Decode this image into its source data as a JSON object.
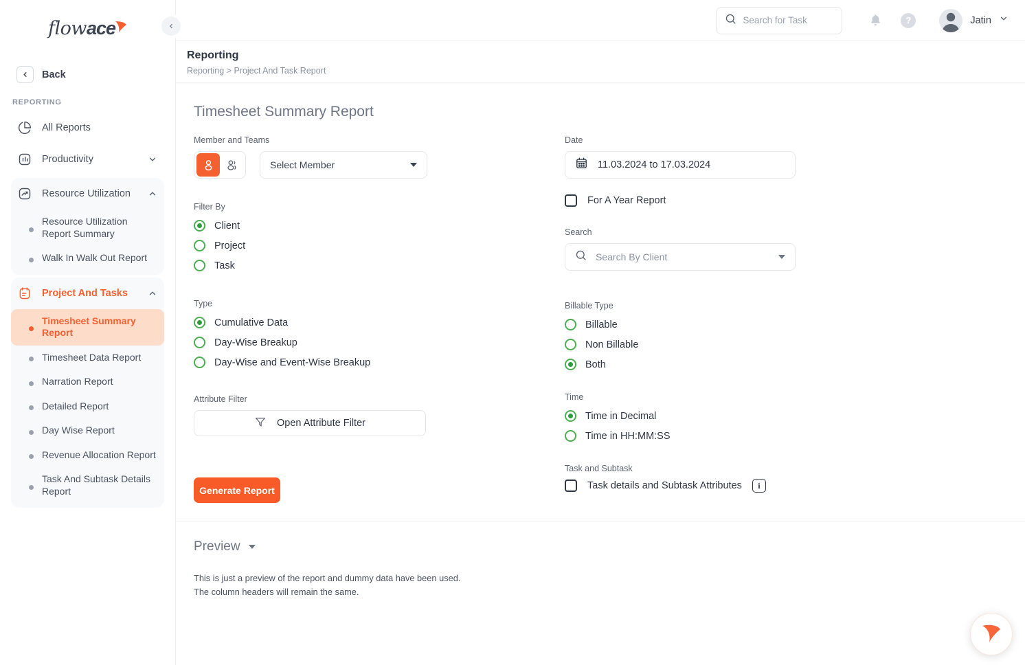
{
  "brand": {
    "logo_text_light": "flow",
    "logo_text_bold": "ace",
    "accent_orange": "#f4602f",
    "button_orange": "#f85a28",
    "radio_green": "#4caf50"
  },
  "sidebar": {
    "back_label": "Back",
    "section_title": "REPORTING",
    "items": [
      {
        "label": "All Reports",
        "icon": "pie-chart-icon"
      },
      {
        "label": "Productivity",
        "icon": "bar-chart-icon",
        "chevron": "chevron-down-icon"
      },
      {
        "label": "Resource Utilization",
        "icon": "trending-up-icon",
        "chevron": "chevron-up-icon"
      }
    ],
    "resource_utilization_children": [
      {
        "label": "Resource Utilization Report Summary"
      },
      {
        "label": "Walk In Walk Out Report"
      }
    ],
    "project_and_tasks": {
      "label": "Project And Tasks",
      "icon": "clipboard-list-icon",
      "chevron": "chevron-up-icon"
    },
    "project_and_tasks_children": [
      {
        "label": "Timesheet Summary Report",
        "active": true
      },
      {
        "label": "Timesheet Data Report",
        "active": false
      },
      {
        "label": "Narration Report",
        "active": false
      },
      {
        "label": "Detailed Report",
        "active": false
      },
      {
        "label": "Day Wise Report",
        "active": false
      },
      {
        "label": "Revenue Allocation Report",
        "active": false
      },
      {
        "label": "Task And Subtask Details Report",
        "active": false
      }
    ]
  },
  "topbar": {
    "search_placeholder": "Search for Task",
    "search_value": "",
    "search_icon": "search-icon",
    "bell_icon": "bell-icon",
    "help_icon": "question-mark-icon",
    "help_label": "?",
    "avatar_icon": "avatar-icon",
    "user_name": "Jatin",
    "user_chevron": "chevron-down-icon",
    "collapse_icon": "chevron-left-icon"
  },
  "page": {
    "title": "Reporting",
    "breadcrumb": "Reporting > Project And Task Report",
    "card_title": "Timesheet Summary Report"
  },
  "form": {
    "member_and_teams": {
      "label": "Member and Teams",
      "toggle_member_icon": "person-icon",
      "toggle_team_icon": "people-icon",
      "toggle_active": "member",
      "select_label": "Select Member",
      "select_caret": "caret-down-icon"
    },
    "date": {
      "label": "Date",
      "calendar_icon": "calendar-icon",
      "value": "11.03.2024 to 17.03.2024"
    },
    "for_a_year": {
      "label": "For A Year Report",
      "checked": false
    },
    "filter_by": {
      "label": "Filter By",
      "options": [
        {
          "label": "Client",
          "checked": true
        },
        {
          "label": "Project",
          "checked": false
        },
        {
          "label": "Task",
          "checked": false
        }
      ]
    },
    "search": {
      "label": "Search",
      "icon": "search-icon",
      "placeholder": "Search By Client",
      "value": "",
      "caret": "caret-down-icon"
    },
    "type": {
      "label": "Type",
      "options": [
        {
          "label": "Cumulative Data",
          "checked": true
        },
        {
          "label": "Day-Wise Breakup",
          "checked": false
        },
        {
          "label": "Day-Wise and Event-Wise Breakup",
          "checked": false
        }
      ]
    },
    "billable_type": {
      "label": "Billable Type",
      "options": [
        {
          "label": "Billable",
          "checked": false
        },
        {
          "label": "Non Billable",
          "checked": false
        },
        {
          "label": "Both",
          "checked": true
        }
      ]
    },
    "attribute_filter": {
      "label": "Attribute Filter",
      "button_label": "Open Attribute Filter",
      "icon": "filter-funnel-icon"
    },
    "time": {
      "label": "Time",
      "options": [
        {
          "label": "Time in Decimal",
          "checked": true
        },
        {
          "label": "Time in HH:MM:SS",
          "checked": false
        }
      ]
    },
    "task_and_subtask": {
      "label": "Task and Subtask",
      "checkbox_label": "Task details and Subtask Attributes",
      "checked": false,
      "info_icon": "info-icon",
      "info_label": "i"
    },
    "generate_button": "Generate Report"
  },
  "preview": {
    "title": "Preview",
    "caret": "caret-down-icon",
    "note_line1": "This is just a preview of the report and dummy data have been used.",
    "note_line2": "The column headers will remain the same."
  },
  "chat_fab": {
    "icon": "flowace-swoosh-icon"
  }
}
